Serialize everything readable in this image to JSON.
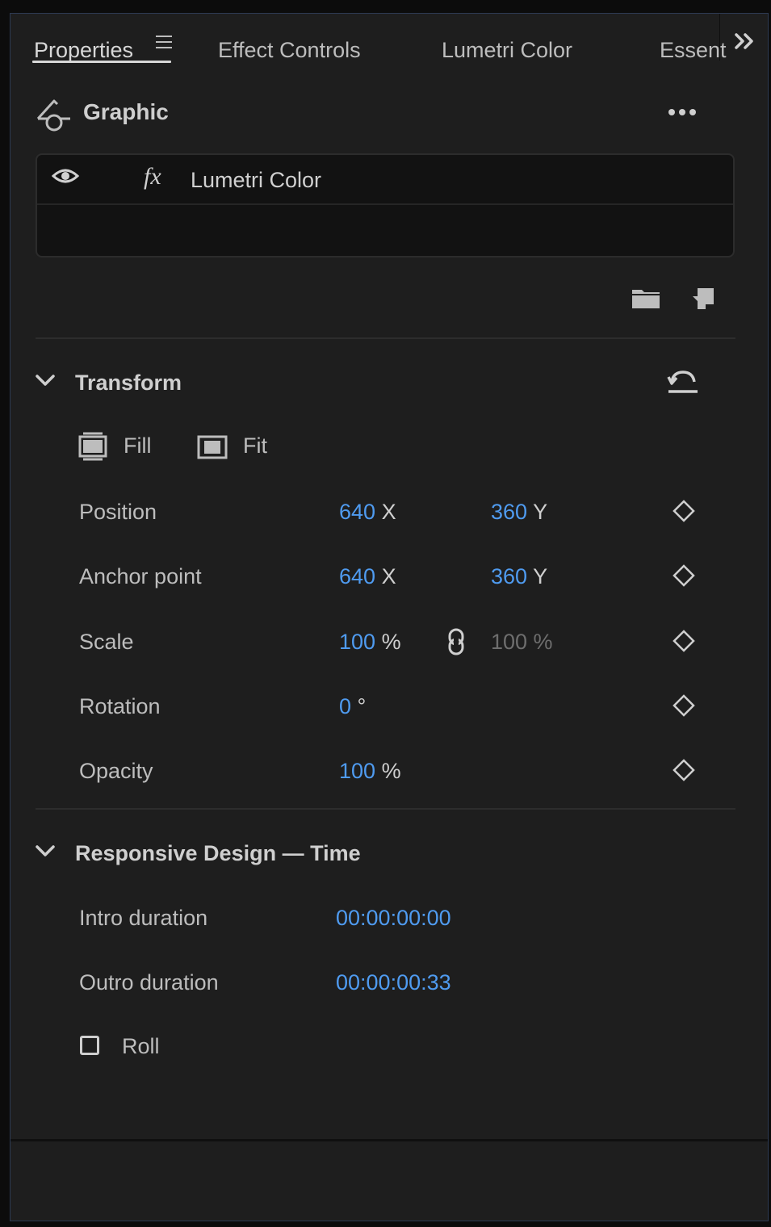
{
  "tabs": [
    {
      "label": "Properties",
      "active": true
    },
    {
      "label": "Effect Controls"
    },
    {
      "label": "Lumetri Color"
    },
    {
      "label": "Essent"
    }
  ],
  "icons": {
    "panel_menu": "hamburger-menu-icon",
    "more_tabs": "double-chevron-right-icon",
    "clip": "graphic-pen-icon",
    "more": "ellipsis-icon",
    "visibility": "eye-icon",
    "effect": "fx-icon",
    "folder": "folder-icon",
    "new_item": "new-item-icon",
    "reset": "reset-icon",
    "keyframe": "diamond-keyframe-icon",
    "link": "link-icon"
  },
  "header": {
    "title": "Graphic"
  },
  "effects": [
    {
      "name": "Lumetri Color",
      "fx": "fx"
    }
  ],
  "transform": {
    "title": "Transform",
    "fill_label": "Fill",
    "fit_label": "Fit",
    "rows": [
      {
        "label": "Position",
        "v1": "640",
        "u1": "X",
        "v2": "360",
        "u2": "Y"
      },
      {
        "label": "Anchor point",
        "v1": "640",
        "u1": "X",
        "v2": "360",
        "u2": "Y"
      },
      {
        "label": "Scale",
        "v1": "100",
        "u1": "%",
        "v2": "100 %",
        "u2": ""
      },
      {
        "label": "Rotation",
        "v1": "0",
        "u1": "°"
      },
      {
        "label": "Opacity",
        "v1": "100",
        "u1": "%"
      }
    ]
  },
  "responsive": {
    "title": "Responsive Design — Time",
    "intro_label": "Intro duration",
    "intro_value": "00:00:00:00",
    "outro_label": "Outro duration",
    "outro_value": "00:00:00:33",
    "roll_label": "Roll",
    "roll_checked": false
  },
  "colors": {
    "accent_blue": "#4f9bf0",
    "panel_bg": "#1e1e1e",
    "text": "#cfcfcf"
  }
}
